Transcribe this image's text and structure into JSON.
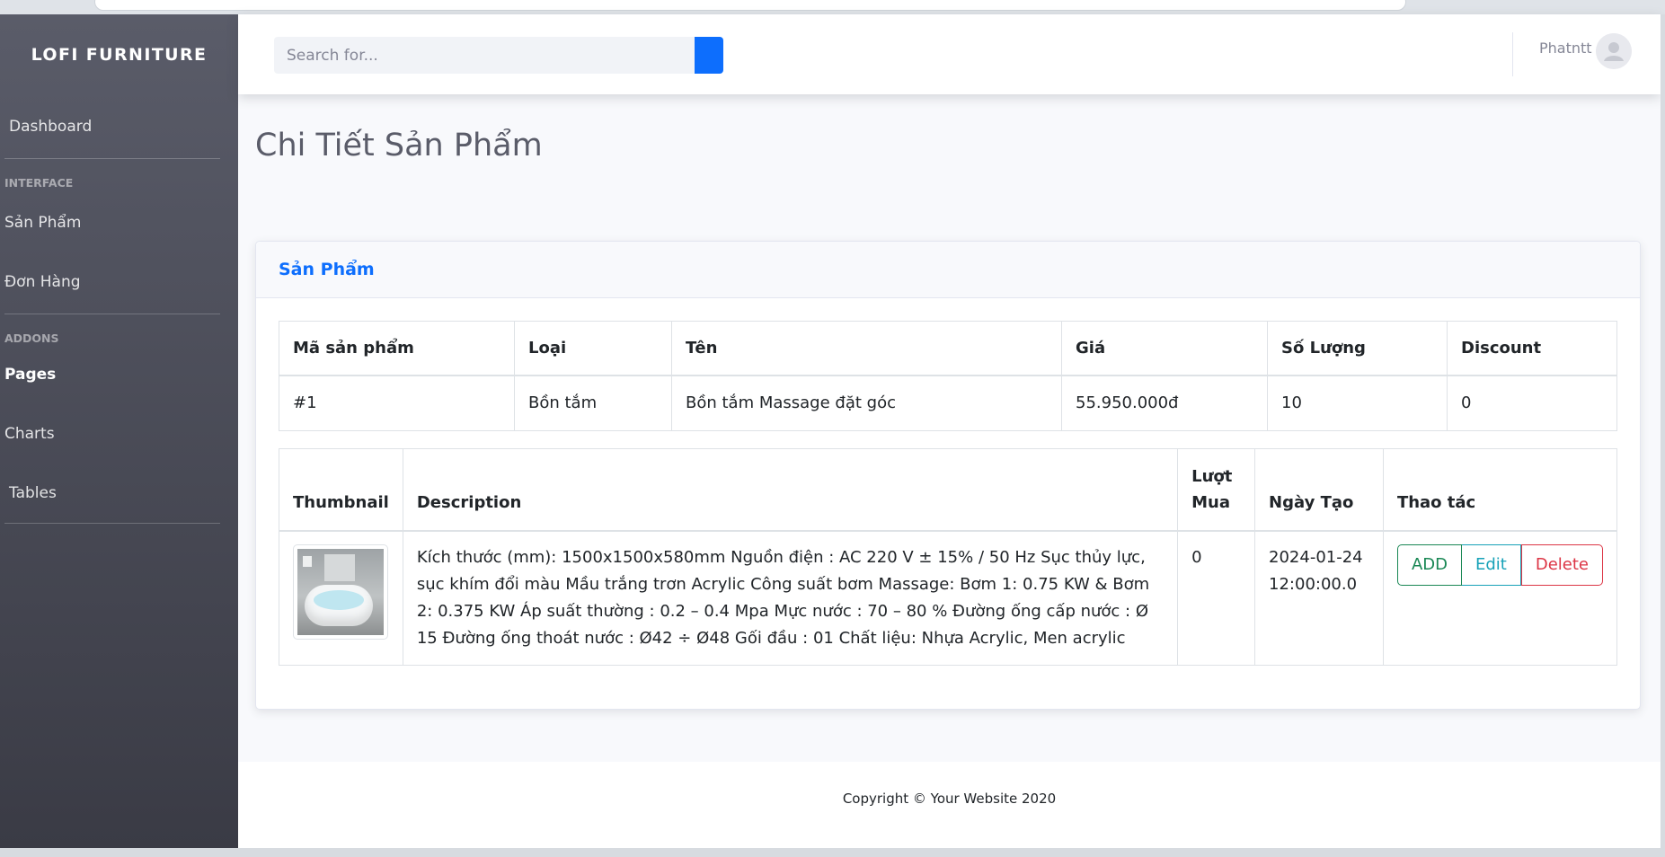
{
  "app": {
    "brand": "LOFI FURNITURE"
  },
  "sidebar": {
    "dashboard": "Dashboard",
    "heading_interface": "INTERFACE",
    "san_pham": "Sản Phẩm",
    "don_hang": "Đơn Hàng",
    "heading_addons": "ADDONS",
    "pages": "Pages",
    "charts": "Charts",
    "tables": "Tables"
  },
  "topbar": {
    "search_placeholder": "Search for...",
    "user_name": "Phatntt"
  },
  "page": {
    "title": "Chi Tiết Sản Phẩm",
    "card_title": "Sản Phẩm"
  },
  "product_table": {
    "headers": [
      "Mã sản phẩm",
      "Loại",
      "Tên",
      "Giá",
      "Số Lượng",
      "Discount"
    ],
    "row": [
      "#1",
      "Bồn tắm",
      "Bồn tắm Massage đặt góc",
      "55.950.000đ",
      "10",
      "0"
    ]
  },
  "detail_table": {
    "headers": [
      "Thumbnail",
      "Description",
      "Lượt Mua",
      "Ngày Tạo",
      "Thao tác"
    ],
    "description": "Kích thước (mm): 1500x1500x580mm Nguồn điện : AC 220 V ± 15% / 50 Hz Sục thủy lực, sục khím đổi màu Mầu trắng trơn Acrylic Công suất bơm Massage: Bơm 1: 0.75 KW & Bơm 2: 0.375 KW Áp suất thường : 0.2 – 0.4 Mpa Mực nước : 70 – 80 % Đường ống cấp nước : Ø 15 Đường ống thoát nước : Ø42 ÷ Ø48 Gối đầu : 01 Chất liệu: Nhựa Acrylic, Men acrylic",
    "luot_mua": "0",
    "ngay_tao": "2024-01-24 12:00:00.0",
    "actions": {
      "add": "ADD",
      "edit": "Edit",
      "delete": "Delete"
    }
  },
  "footer": {
    "text": "Copyright © Your Website 2020"
  },
  "colors": {
    "primary": "#0d6efd",
    "success": "#198754",
    "info": "#17a2b8",
    "danger": "#dc3545",
    "sidebar_top": "#5a5c69",
    "sidebar_bottom": "#3a3b45"
  },
  "icons": {
    "avatar": "user-avatar-icon",
    "search": "search-icon"
  }
}
